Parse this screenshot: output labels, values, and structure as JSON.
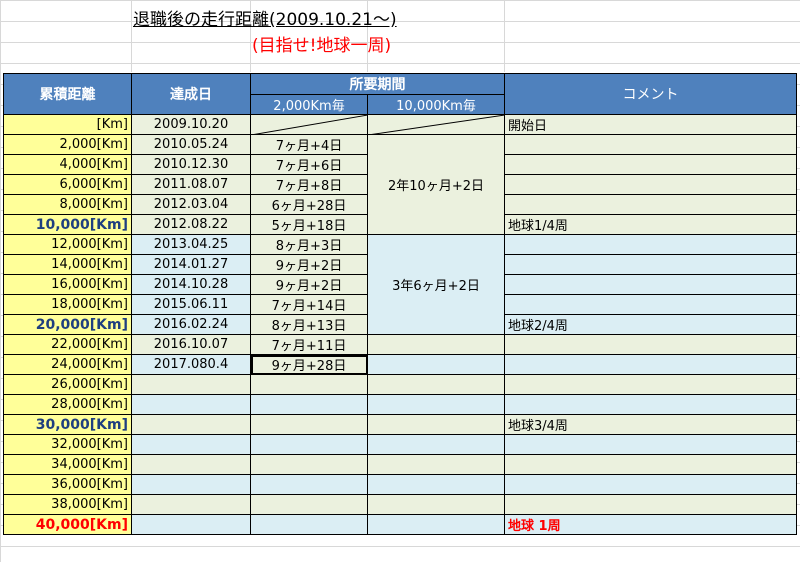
{
  "title": "退職後の走行距離(2009.10.21〜)",
  "subtitle": "(目指せ!地球一周)",
  "headers": {
    "distance": "累積距離",
    "date": "達成日",
    "period": "所要期間",
    "per2000": "2,000Km毎",
    "per10000": "10,000Km毎",
    "comment": "コメント"
  },
  "rows": [
    {
      "dist": "[Km]",
      "date": "2009.10.20",
      "span": "",
      "comment": "開始日"
    },
    {
      "dist": "2,000[Km]",
      "date": "2010.05.24",
      "span": "7ヶ月+4日",
      "comment": ""
    },
    {
      "dist": "4,000[Km]",
      "date": "2010.12.30",
      "span": "7ヶ月+6日",
      "comment": ""
    },
    {
      "dist": "6,000[Km]",
      "date": "2011.08.07",
      "span": "7ヶ月+8日",
      "comment": ""
    },
    {
      "dist": "8,000[Km]",
      "date": "2012.03.04",
      "span": "6ヶ月+28日",
      "comment": ""
    },
    {
      "dist": "10,000[Km]",
      "date": "2012.08.22",
      "span": "5ヶ月+18日",
      "comment": "地球1/4周"
    },
    {
      "dist": "12,000[Km]",
      "date": "2013.04.25",
      "span": "8ヶ月+3日",
      "comment": ""
    },
    {
      "dist": "14,000[Km]",
      "date": "2014.01.27",
      "span": "9ヶ月+2日",
      "comment": ""
    },
    {
      "dist": "16,000[Km]",
      "date": "2014.10.28",
      "span": "9ヶ月+2日",
      "comment": ""
    },
    {
      "dist": "18,000[Km]",
      "date": "2015.06.11",
      "span": "7ヶ月+14日",
      "comment": ""
    },
    {
      "dist": "20,000[Km]",
      "date": "2016.02.24",
      "span": "8ヶ月+13日",
      "comment": "地球2/4周"
    },
    {
      "dist": "22,000[Km]",
      "date": "2016.10.07",
      "span": "7ヶ月+11日",
      "comment": ""
    },
    {
      "dist": "24,000[Km]",
      "date": "2017.080.4",
      "span": "9ヶ月+28日",
      "comment": ""
    },
    {
      "dist": "26,000[Km]",
      "date": "",
      "span": "",
      "comment": ""
    },
    {
      "dist": "28,000[Km]",
      "date": "",
      "span": "",
      "comment": ""
    },
    {
      "dist": "30,000[Km]",
      "date": "",
      "span": "",
      "comment": "地球3/4周"
    },
    {
      "dist": "32,000[Km]",
      "date": "",
      "span": "",
      "comment": ""
    },
    {
      "dist": "34,000[Km]",
      "date": "",
      "span": "",
      "comment": ""
    },
    {
      "dist": "36,000[Km]",
      "date": "",
      "span": "",
      "comment": ""
    },
    {
      "dist": "38,000[Km]",
      "date": "",
      "span": "",
      "comment": ""
    },
    {
      "dist": "40,000[Km]",
      "date": "",
      "span": "",
      "comment": "地球 1周"
    }
  ],
  "span10k": [
    "2年10ヶ月+2日",
    "3年6ヶ月+2日"
  ],
  "colors": {
    "header": "#4f81bd",
    "distance_bg": "#ffff99",
    "green_band": "#ebf1de",
    "blue_band": "#dbeef4",
    "milestone_text": "#1f3f7f",
    "goal_text": "#ff0000"
  }
}
